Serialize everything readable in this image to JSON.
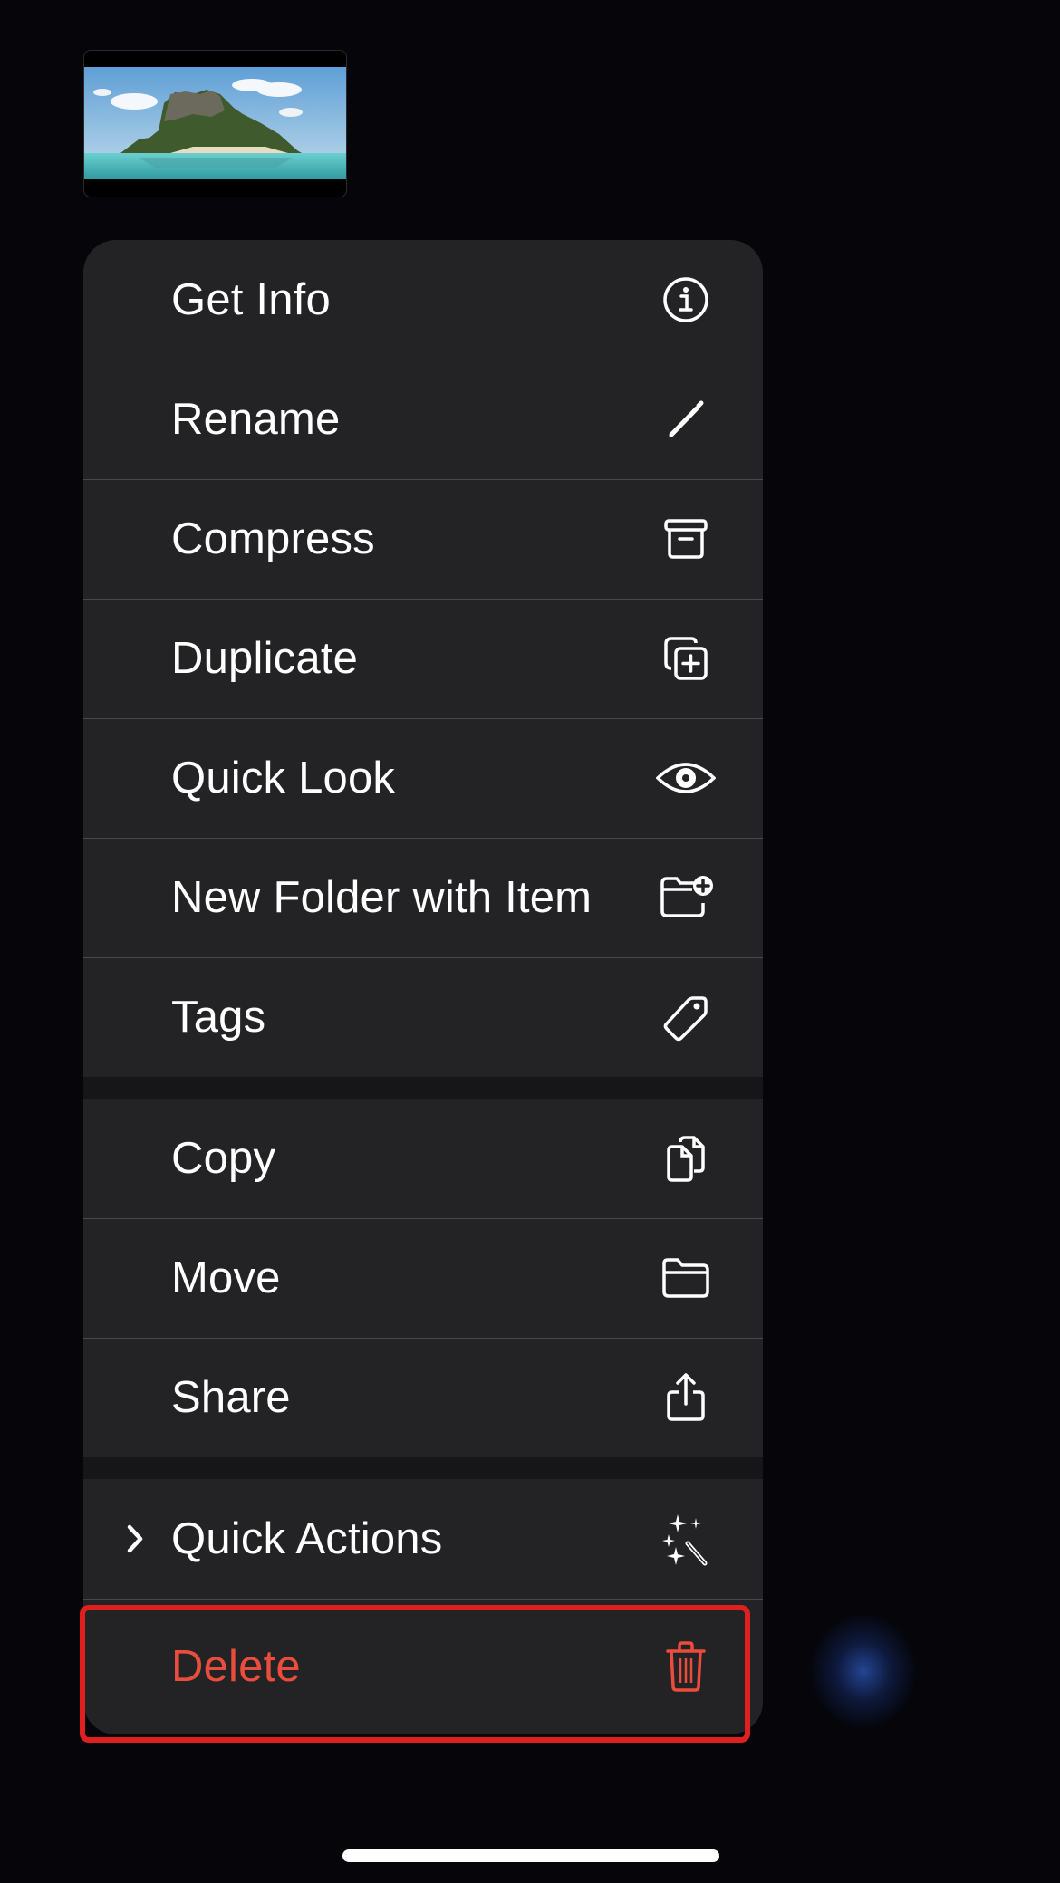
{
  "preview": {
    "subject": "island-landscape-image",
    "alt": "Photo of a rocky green island surrounded by turquoise water"
  },
  "menu": {
    "groups": [
      {
        "items": [
          {
            "label": "Get Info",
            "icon": "info-circle-icon"
          },
          {
            "label": "Rename",
            "icon": "pencil-icon"
          },
          {
            "label": "Compress",
            "icon": "archive-box-icon"
          },
          {
            "label": "Duplicate",
            "icon": "duplicate-plus-icon"
          },
          {
            "label": "Quick Look",
            "icon": "eye-icon"
          },
          {
            "label": "New Folder with Item",
            "icon": "folder-badge-plus-icon"
          },
          {
            "label": "Tags",
            "icon": "tag-icon"
          }
        ]
      },
      {
        "items": [
          {
            "label": "Copy",
            "icon": "doc-on-doc-icon"
          },
          {
            "label": "Move",
            "icon": "folder-icon"
          },
          {
            "label": "Share",
            "icon": "share-icon"
          }
        ]
      },
      {
        "items": [
          {
            "label": "Quick Actions",
            "icon": "magic-wand-icon",
            "has_submenu": true,
            "submenu_indicator": "chevron-right-icon"
          },
          {
            "label": "Delete",
            "icon": "trash-icon",
            "destructive": true,
            "highlighted": true
          }
        ]
      }
    ]
  },
  "colors": {
    "background": "#05050a",
    "menu_row": "#232325",
    "destructive": "#eb4d3d",
    "highlight_box": "#e0201f"
  }
}
